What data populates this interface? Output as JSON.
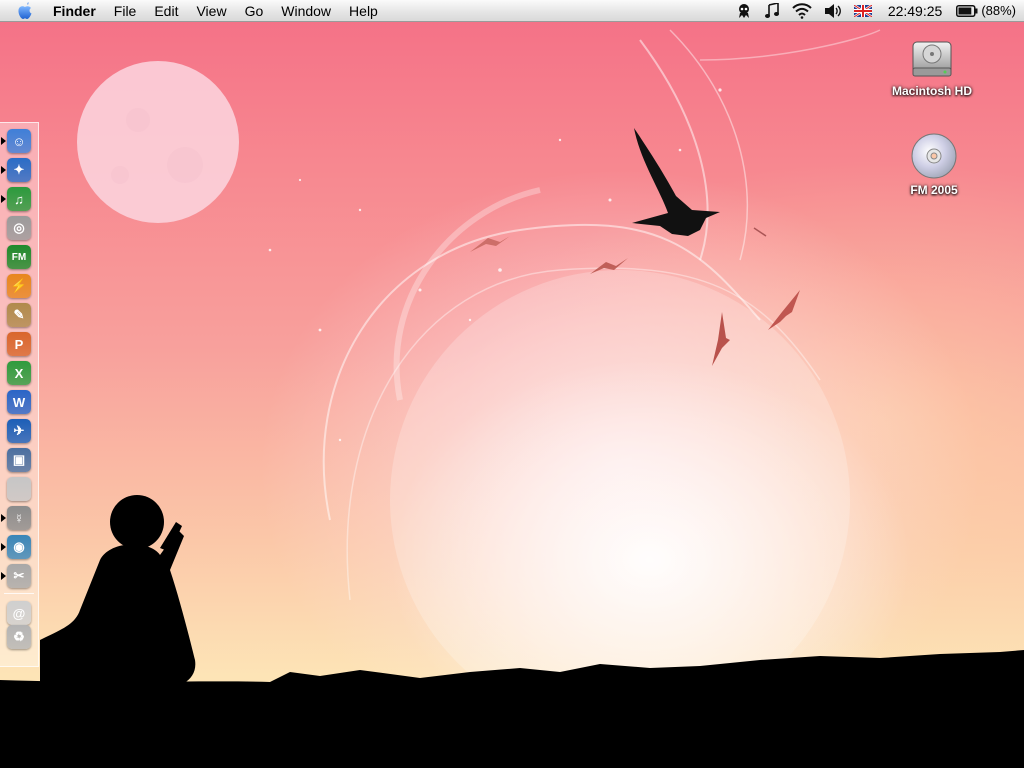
{
  "menubar": {
    "apple_icon": "apple-logo-icon",
    "app_name": "Finder",
    "items": [
      "File",
      "Edit",
      "View",
      "Go",
      "Window",
      "Help"
    ],
    "extras": [
      "alien-icon",
      "music-note-icon",
      "wifi-icon",
      "volume-icon",
      "uk-flag-icon"
    ],
    "clock": "22:49:25",
    "battery": "(88%)",
    "battery_level": 0.88
  },
  "desktop": {
    "icons": [
      {
        "label": "Macintosh HD",
        "icon": "hard-drive-icon"
      },
      {
        "label": "FM 2005",
        "icon": "cd-disc-icon"
      }
    ]
  },
  "dock": {
    "items": [
      {
        "icon": "finder-icon",
        "running": true,
        "color": "#3f7fd8",
        "glyph": "☺"
      },
      {
        "icon": "safari-icon",
        "running": true,
        "color": "#2a6cc6",
        "glyph": "✦"
      },
      {
        "icon": "itunes-icon",
        "running": true,
        "color": "#2b9a3c",
        "glyph": "♫"
      },
      {
        "icon": "dvd-player-icon",
        "running": false,
        "color": "#9b9b9b",
        "glyph": "◎"
      },
      {
        "icon": "football-manager-icon",
        "running": false,
        "color": "#1f8a2b",
        "glyph": "FM"
      },
      {
        "icon": "lightning-app-icon",
        "running": false,
        "color": "#e8861e",
        "glyph": "⚡"
      },
      {
        "icon": "gimp-icon",
        "running": false,
        "color": "#b08a4c",
        "glyph": "✎"
      },
      {
        "icon": "powerpoint-icon",
        "running": false,
        "color": "#d9662c",
        "glyph": "P"
      },
      {
        "icon": "excel-icon",
        "running": false,
        "color": "#2f9b3d",
        "glyph": "X"
      },
      {
        "icon": "word-icon",
        "running": false,
        "color": "#2a65c7",
        "glyph": "W"
      },
      {
        "icon": "messenger-bird-icon",
        "running": false,
        "color": "#1c5fb8",
        "glyph": "✈"
      },
      {
        "icon": "iphoto-icon",
        "running": false,
        "color": "#4a6fa0",
        "glyph": "▣"
      },
      {
        "icon": "apple-app-icon",
        "running": false,
        "color": "#c6c6c6",
        "glyph": ""
      },
      {
        "icon": "mercury-icon",
        "running": true,
        "color": "#8c8c8c",
        "glyph": "☿"
      },
      {
        "icon": "adium-duck-icon",
        "running": true,
        "color": "#3a86b8",
        "glyph": "◉"
      },
      {
        "icon": "utilities-icon",
        "running": true,
        "color": "#a8a8a8",
        "glyph": "✂"
      }
    ],
    "trailing": [
      {
        "icon": "mail-at-icon",
        "color": "#cfcfcf",
        "glyph": "@"
      },
      {
        "icon": "trash-icon",
        "color": "#b4b4b4",
        "glyph": "♻"
      }
    ]
  }
}
